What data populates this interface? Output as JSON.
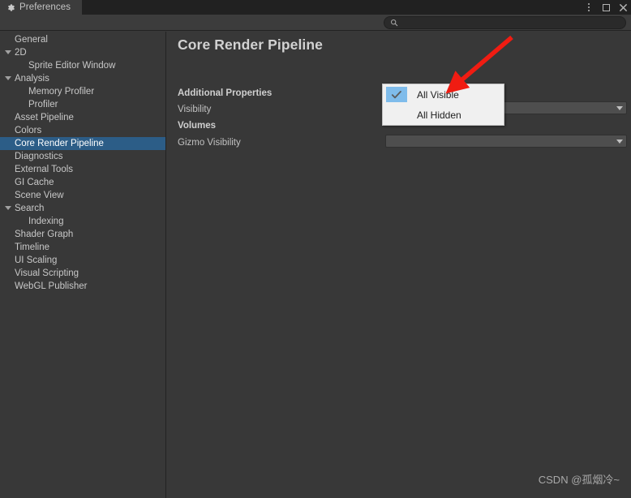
{
  "window": {
    "tab_label": "Preferences",
    "tab_icon": "gear-icon",
    "controls": {
      "menu_icon": "kebab-menu-icon",
      "maximize_icon": "maximize-icon",
      "close_icon": "close-icon"
    }
  },
  "toolbar": {
    "search_placeholder": "",
    "search_value": "",
    "search_icon": "search-icon"
  },
  "sidebar": {
    "items": [
      {
        "label": "General",
        "level": 0,
        "foldout": false,
        "selected": false
      },
      {
        "label": "2D",
        "level": 0,
        "foldout": true,
        "selected": false
      },
      {
        "label": "Sprite Editor Window",
        "level": 1,
        "foldout": false,
        "selected": false
      },
      {
        "label": "Analysis",
        "level": 0,
        "foldout": true,
        "selected": false
      },
      {
        "label": "Memory Profiler",
        "level": 1,
        "foldout": false,
        "selected": false
      },
      {
        "label": "Profiler",
        "level": 1,
        "foldout": false,
        "selected": false
      },
      {
        "label": "Asset Pipeline",
        "level": 0,
        "foldout": false,
        "selected": false
      },
      {
        "label": "Colors",
        "level": 0,
        "foldout": false,
        "selected": false
      },
      {
        "label": "Core Render Pipeline",
        "level": 0,
        "foldout": false,
        "selected": true
      },
      {
        "label": "Diagnostics",
        "level": 0,
        "foldout": false,
        "selected": false
      },
      {
        "label": "External Tools",
        "level": 0,
        "foldout": false,
        "selected": false
      },
      {
        "label": "GI Cache",
        "level": 0,
        "foldout": false,
        "selected": false
      },
      {
        "label": "Scene View",
        "level": 0,
        "foldout": false,
        "selected": false
      },
      {
        "label": "Search",
        "level": 0,
        "foldout": true,
        "selected": false
      },
      {
        "label": "Indexing",
        "level": 1,
        "foldout": false,
        "selected": false
      },
      {
        "label": "Shader Graph",
        "level": 0,
        "foldout": false,
        "selected": false
      },
      {
        "label": "Timeline",
        "level": 0,
        "foldout": false,
        "selected": false
      },
      {
        "label": "UI Scaling",
        "level": 0,
        "foldout": false,
        "selected": false
      },
      {
        "label": "Visual Scripting",
        "level": 0,
        "foldout": false,
        "selected": false
      },
      {
        "label": "WebGL Publisher",
        "level": 0,
        "foldout": false,
        "selected": false
      }
    ]
  },
  "content": {
    "title": "Core Render Pipeline",
    "sections": [
      {
        "header": "Additional Properties",
        "field_label": "Visibility",
        "field_value": "All Visible"
      },
      {
        "header": "Volumes",
        "field_label": "Gizmo Visibility",
        "field_value": ""
      }
    ]
  },
  "popup": {
    "items": [
      {
        "label": "All Visible",
        "checked": true
      },
      {
        "label": "All Hidden",
        "checked": false
      }
    ]
  },
  "annotation": {
    "arrow_color": "#F01C12"
  },
  "watermark": {
    "text": "CSDN @孤烟冷~"
  },
  "colors": {
    "background": "#383838",
    "titlebar": "#212121",
    "selection": "#2C5D87",
    "popup_bg": "#F0F0F0",
    "check_highlight": "#7FBCEB",
    "field_bg": "#4E4E4E"
  }
}
